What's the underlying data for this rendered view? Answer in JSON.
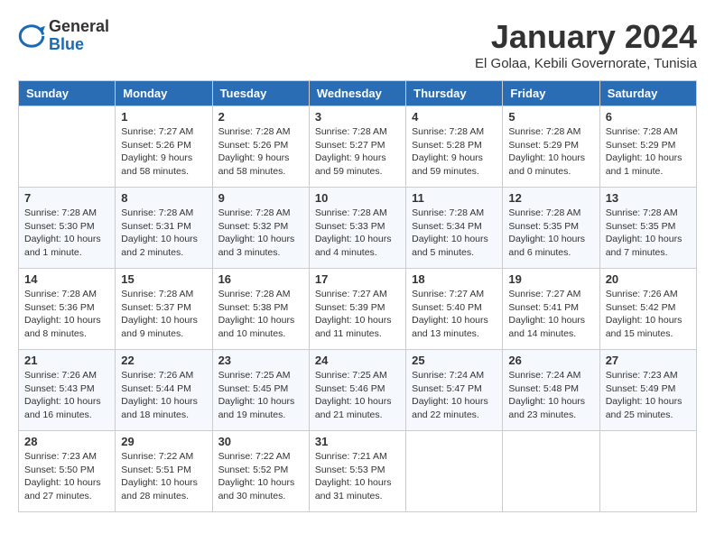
{
  "logo": {
    "general": "General",
    "blue": "Blue"
  },
  "title": "January 2024",
  "subtitle": "El Golaa, Kebili Governorate, Tunisia",
  "days_of_week": [
    "Sunday",
    "Monday",
    "Tuesday",
    "Wednesday",
    "Thursday",
    "Friday",
    "Saturday"
  ],
  "weeks": [
    [
      {
        "day": "",
        "info": ""
      },
      {
        "day": "1",
        "info": "Sunrise: 7:27 AM\nSunset: 5:26 PM\nDaylight: 9 hours\nand 58 minutes."
      },
      {
        "day": "2",
        "info": "Sunrise: 7:28 AM\nSunset: 5:26 PM\nDaylight: 9 hours\nand 58 minutes."
      },
      {
        "day": "3",
        "info": "Sunrise: 7:28 AM\nSunset: 5:27 PM\nDaylight: 9 hours\nand 59 minutes."
      },
      {
        "day": "4",
        "info": "Sunrise: 7:28 AM\nSunset: 5:28 PM\nDaylight: 9 hours\nand 59 minutes."
      },
      {
        "day": "5",
        "info": "Sunrise: 7:28 AM\nSunset: 5:29 PM\nDaylight: 10 hours\nand 0 minutes."
      },
      {
        "day": "6",
        "info": "Sunrise: 7:28 AM\nSunset: 5:29 PM\nDaylight: 10 hours\nand 1 minute."
      }
    ],
    [
      {
        "day": "7",
        "info": "Sunrise: 7:28 AM\nSunset: 5:30 PM\nDaylight: 10 hours\nand 1 minute."
      },
      {
        "day": "8",
        "info": "Sunrise: 7:28 AM\nSunset: 5:31 PM\nDaylight: 10 hours\nand 2 minutes."
      },
      {
        "day": "9",
        "info": "Sunrise: 7:28 AM\nSunset: 5:32 PM\nDaylight: 10 hours\nand 3 minutes."
      },
      {
        "day": "10",
        "info": "Sunrise: 7:28 AM\nSunset: 5:33 PM\nDaylight: 10 hours\nand 4 minutes."
      },
      {
        "day": "11",
        "info": "Sunrise: 7:28 AM\nSunset: 5:34 PM\nDaylight: 10 hours\nand 5 minutes."
      },
      {
        "day": "12",
        "info": "Sunrise: 7:28 AM\nSunset: 5:35 PM\nDaylight: 10 hours\nand 6 minutes."
      },
      {
        "day": "13",
        "info": "Sunrise: 7:28 AM\nSunset: 5:35 PM\nDaylight: 10 hours\nand 7 minutes."
      }
    ],
    [
      {
        "day": "14",
        "info": "Sunrise: 7:28 AM\nSunset: 5:36 PM\nDaylight: 10 hours\nand 8 minutes."
      },
      {
        "day": "15",
        "info": "Sunrise: 7:28 AM\nSunset: 5:37 PM\nDaylight: 10 hours\nand 9 minutes."
      },
      {
        "day": "16",
        "info": "Sunrise: 7:28 AM\nSunset: 5:38 PM\nDaylight: 10 hours\nand 10 minutes."
      },
      {
        "day": "17",
        "info": "Sunrise: 7:27 AM\nSunset: 5:39 PM\nDaylight: 10 hours\nand 11 minutes."
      },
      {
        "day": "18",
        "info": "Sunrise: 7:27 AM\nSunset: 5:40 PM\nDaylight: 10 hours\nand 13 minutes."
      },
      {
        "day": "19",
        "info": "Sunrise: 7:27 AM\nSunset: 5:41 PM\nDaylight: 10 hours\nand 14 minutes."
      },
      {
        "day": "20",
        "info": "Sunrise: 7:26 AM\nSunset: 5:42 PM\nDaylight: 10 hours\nand 15 minutes."
      }
    ],
    [
      {
        "day": "21",
        "info": "Sunrise: 7:26 AM\nSunset: 5:43 PM\nDaylight: 10 hours\nand 16 minutes."
      },
      {
        "day": "22",
        "info": "Sunrise: 7:26 AM\nSunset: 5:44 PM\nDaylight: 10 hours\nand 18 minutes."
      },
      {
        "day": "23",
        "info": "Sunrise: 7:25 AM\nSunset: 5:45 PM\nDaylight: 10 hours\nand 19 minutes."
      },
      {
        "day": "24",
        "info": "Sunrise: 7:25 AM\nSunset: 5:46 PM\nDaylight: 10 hours\nand 21 minutes."
      },
      {
        "day": "25",
        "info": "Sunrise: 7:24 AM\nSunset: 5:47 PM\nDaylight: 10 hours\nand 22 minutes."
      },
      {
        "day": "26",
        "info": "Sunrise: 7:24 AM\nSunset: 5:48 PM\nDaylight: 10 hours\nand 23 minutes."
      },
      {
        "day": "27",
        "info": "Sunrise: 7:23 AM\nSunset: 5:49 PM\nDaylight: 10 hours\nand 25 minutes."
      }
    ],
    [
      {
        "day": "28",
        "info": "Sunrise: 7:23 AM\nSunset: 5:50 PM\nDaylight: 10 hours\nand 27 minutes."
      },
      {
        "day": "29",
        "info": "Sunrise: 7:22 AM\nSunset: 5:51 PM\nDaylight: 10 hours\nand 28 minutes."
      },
      {
        "day": "30",
        "info": "Sunrise: 7:22 AM\nSunset: 5:52 PM\nDaylight: 10 hours\nand 30 minutes."
      },
      {
        "day": "31",
        "info": "Sunrise: 7:21 AM\nSunset: 5:53 PM\nDaylight: 10 hours\nand 31 minutes."
      },
      {
        "day": "",
        "info": ""
      },
      {
        "day": "",
        "info": ""
      },
      {
        "day": "",
        "info": ""
      }
    ]
  ]
}
